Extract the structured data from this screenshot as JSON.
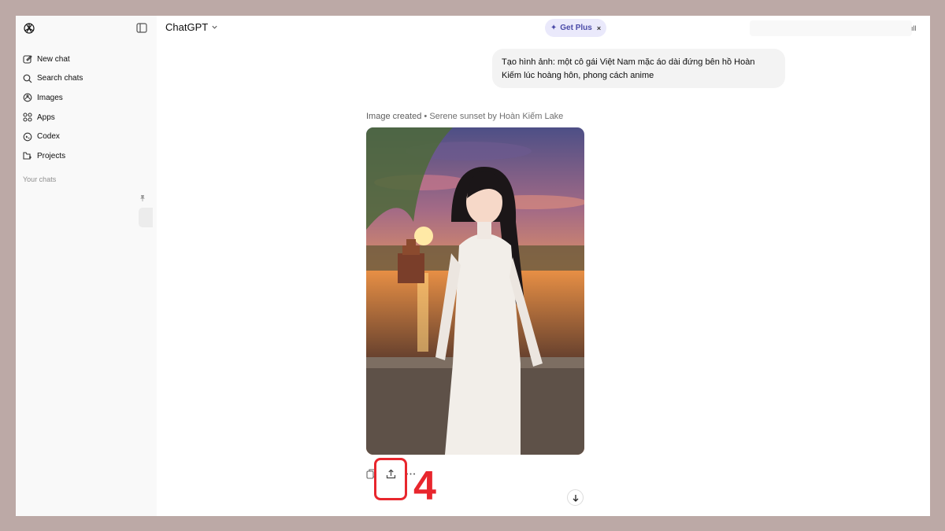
{
  "app": {
    "title": "ChatGPT"
  },
  "sidebar": {
    "items": [
      {
        "label": "New chat",
        "icon": "edit-icon"
      },
      {
        "label": "Search chats",
        "icon": "search-icon"
      },
      {
        "label": "Images",
        "icon": "images-icon"
      },
      {
        "label": "Apps",
        "icon": "apps-icon"
      },
      {
        "label": "Codex",
        "icon": "codex-icon"
      },
      {
        "label": "Projects",
        "icon": "projects-icon"
      }
    ],
    "section_label": "Your chats"
  },
  "header": {
    "model_label": "ChatGPT",
    "get_plus_label": "Get Plus",
    "get_plus_close": "×"
  },
  "conversation": {
    "user_message": "Tạo hình ảnh: một cô gái Việt Nam mặc áo dài đứng bên hồ Hoàn Kiếm lúc hoàng hôn, phong cách anime",
    "image_status": "Image created",
    "image_separator": "•",
    "image_title": "Serene sunset by Hoàn Kiếm Lake"
  },
  "annotation": {
    "step_number": "4",
    "color": "#e8262d"
  },
  "colors": {
    "page_background": "#bca9a6",
    "sidebar_background": "#f9f9f9",
    "get_plus_background": "#eae9fb",
    "get_plus_text": "#4b4ba8",
    "user_bubble": "#f3f3f3"
  }
}
